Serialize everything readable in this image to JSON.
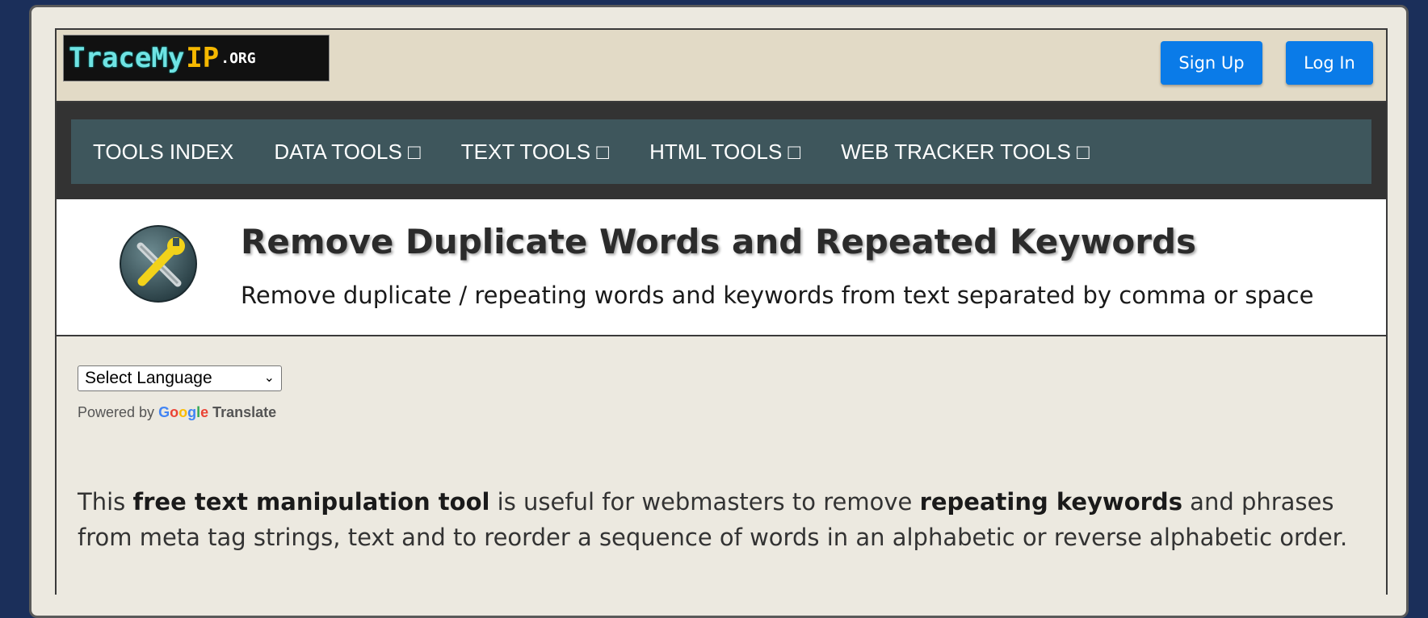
{
  "header": {
    "logo": {
      "trace": "TraceMy",
      "ip": "IP",
      "org": ".ORG"
    },
    "signup_label": "Sign Up",
    "login_label": "Log In"
  },
  "nav": {
    "items": [
      {
        "label": "TOOLS INDEX"
      },
      {
        "label": "DATA TOOLS □"
      },
      {
        "label": "TEXT TOOLS □"
      },
      {
        "label": "HTML TOOLS □"
      },
      {
        "label": "WEB TRACKER TOOLS □"
      }
    ]
  },
  "hero": {
    "icon": "tools-icon",
    "title": "Remove Duplicate Words and Repeated Keywords",
    "subtitle": "Remove duplicate / repeating words and keywords from text separated by comma or space"
  },
  "translate": {
    "selected": "Select Language",
    "powered_by": "Powered by",
    "google": [
      "G",
      "o",
      "o",
      "g",
      "l",
      "e"
    ],
    "translate": "Translate"
  },
  "intro": {
    "p1": "This ",
    "b1": "free text manipulation tool",
    "p2": " is useful for webmasters to remove ",
    "b2": "repeating keywords",
    "p3": " and phrases from meta tag strings, text and to reorder a sequence of words in an alphabetic or reverse alphabetic order."
  },
  "colors": {
    "background": "#1b2f5a",
    "page": "#ece9e0",
    "header": "#e2dac6",
    "nav": "#3e565c",
    "button": "#0a7be8"
  }
}
